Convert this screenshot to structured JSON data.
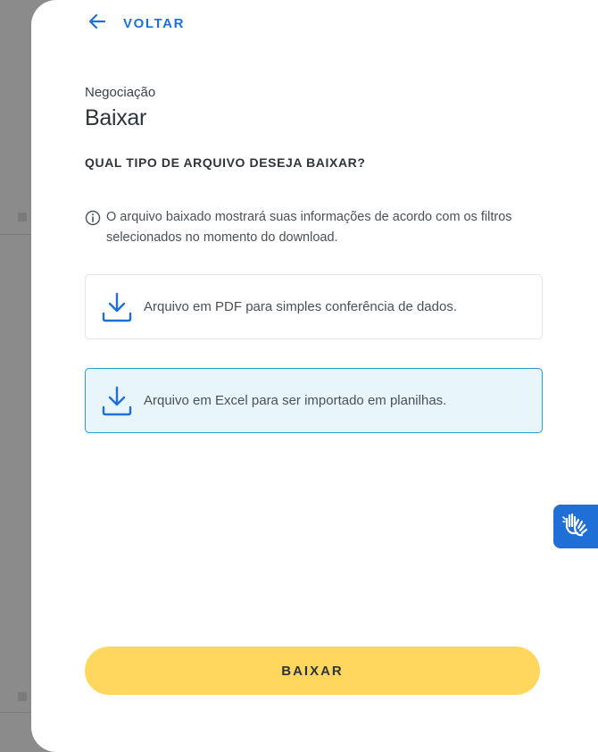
{
  "nav": {
    "back_label": "VOLTAR"
  },
  "header": {
    "breadcrumb": "Negociação",
    "title": "Baixar"
  },
  "question": "QUAL TIPO DE ARQUIVO DESEJA BAIXAR?",
  "info": {
    "line1": "O arquivo baixado mostrará suas informações de acordo com os filtros",
    "line2": "selecionados no momento do download."
  },
  "options": [
    {
      "label": "Arquivo em PDF para simples conferência de dados.",
      "icon": "download-icon",
      "selected": false
    },
    {
      "label": "Arquivo em Excel para ser importado em planilhas.",
      "icon": "download-icon",
      "selected": true
    }
  ],
  "actions": {
    "download_label": "BAIXAR"
  },
  "colors": {
    "accent": "#1f6fd6",
    "primary_button": "#ffd75e",
    "selected_bg": "#e8f6fc",
    "selected_border": "#2a9bd1"
  },
  "floating": {
    "icon": "sign-language-hands-icon"
  }
}
